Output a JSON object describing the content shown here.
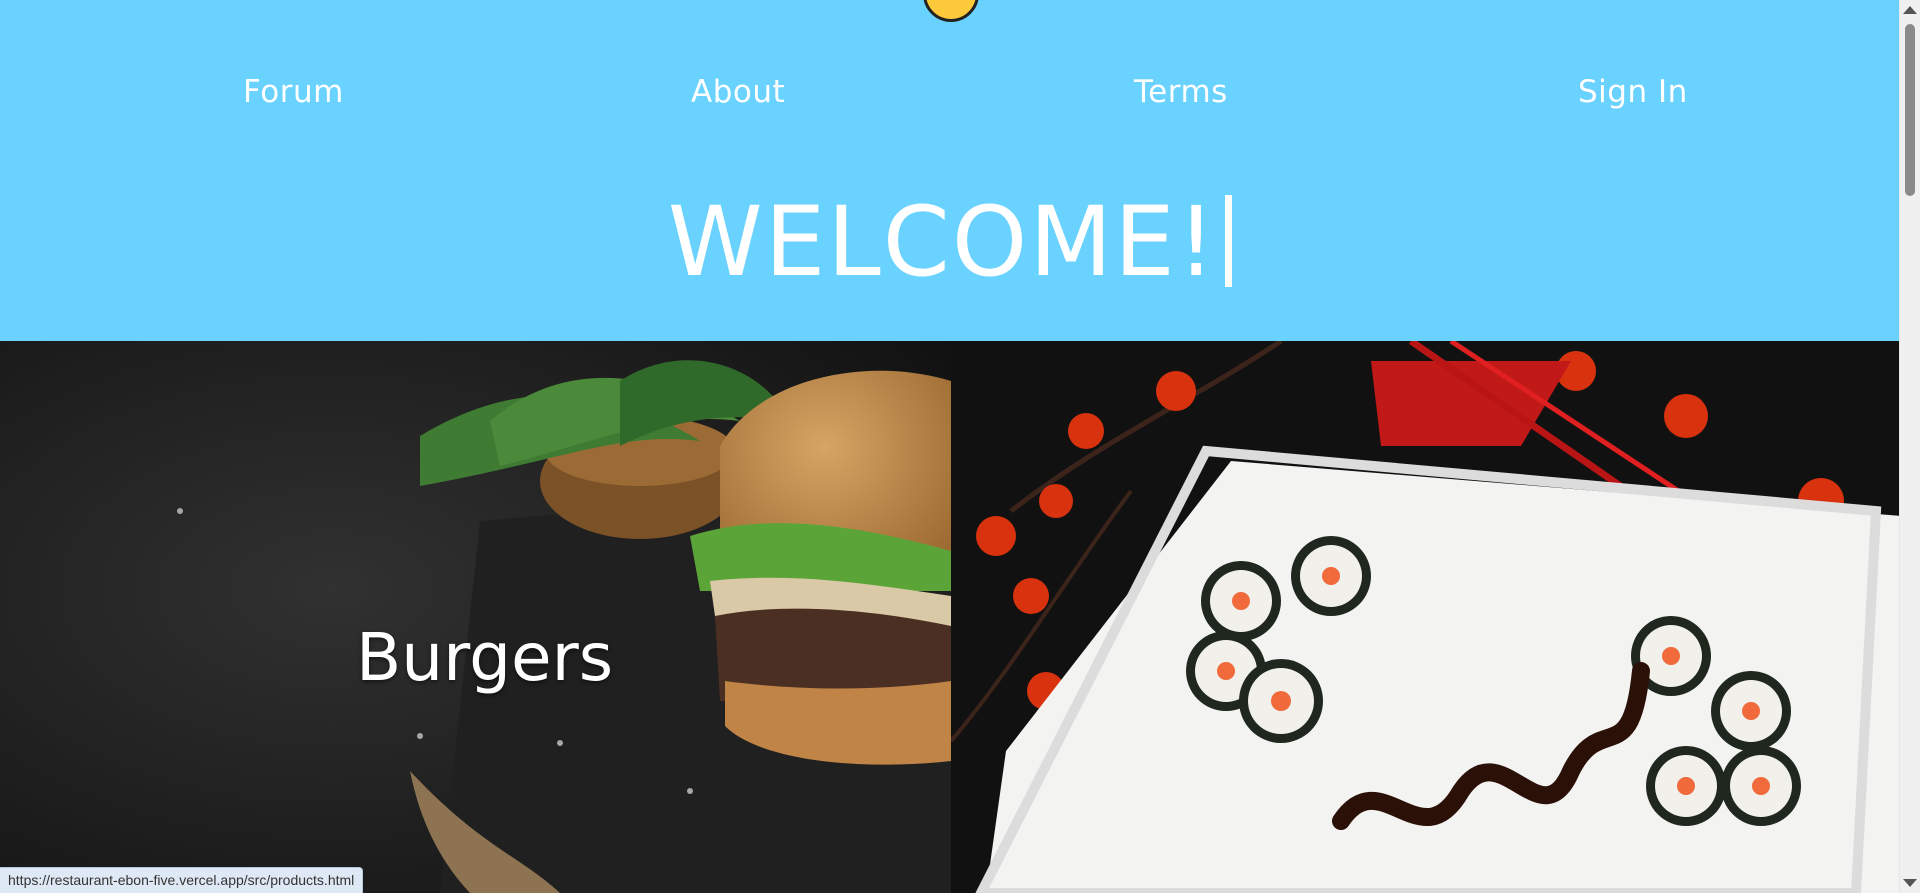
{
  "nav": {
    "forum": "Forum",
    "about": "About",
    "terms": "Terms",
    "sign_in": "Sign In"
  },
  "hero": {
    "welcome": "WELCOME!"
  },
  "cards": {
    "burgers": "Burgers"
  },
  "status_bar": {
    "url": "https://restaurant-ebon-five.vercel.app/src/products.html"
  },
  "colors": {
    "header": "#69d2ff",
    "text": "#ffffff"
  }
}
